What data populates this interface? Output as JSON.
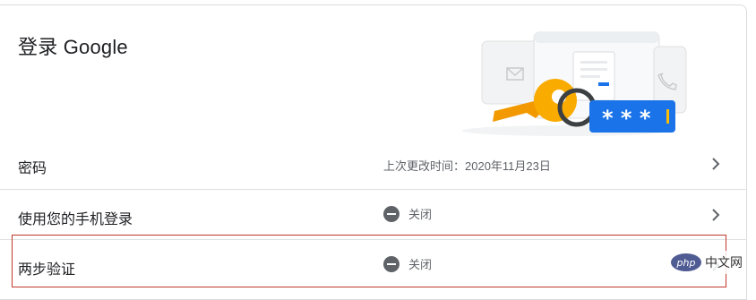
{
  "card": {
    "title": "登录 Google"
  },
  "rows": [
    {
      "label": "密码",
      "value": "上次更改时间：2020年11月23日"
    },
    {
      "label": "使用您的手机登录",
      "value": "关闭"
    },
    {
      "label": "两步验证",
      "value": "关闭"
    }
  ],
  "watermark": {
    "logo": "php",
    "text": "中文网"
  },
  "colors": {
    "highlight_border": "#c0392b",
    "key": "#f9ab00",
    "password_box": "#1a73e8",
    "status_icon": "#5f6368"
  },
  "icons": {
    "row_chevron": "chevron-right-icon",
    "status": "minus-circle-icon"
  }
}
